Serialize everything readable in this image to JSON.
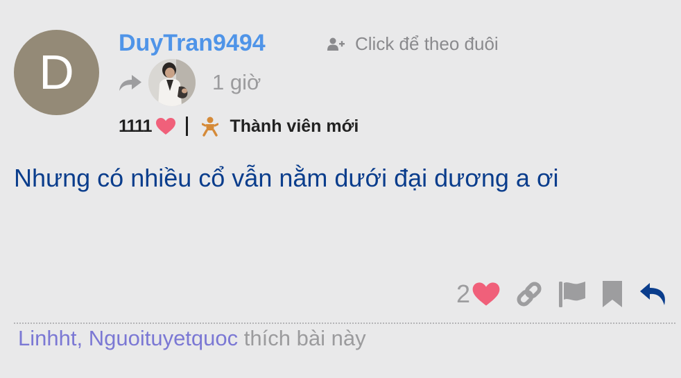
{
  "post": {
    "author": {
      "avatar_letter": "D",
      "avatar_color": "#948a77",
      "username": "DuyTran9494",
      "username_color": "#4f94e8"
    },
    "follow_label": "Click để theo đuôi",
    "follow_icon": "user-plus-icon",
    "shared_via": {
      "icon": "share-arrow-icon",
      "avatar": "shared-user-avatar"
    },
    "time": "1 giờ",
    "stats": {
      "likes_count": "1111",
      "likes_icon": "heart-icon",
      "rank_icon": "baby-icon",
      "rank_label": "Thành viên mới"
    },
    "content": "Nhưng có nhiều cổ vẫn nằm dưới đại dương a ơi",
    "content_color": "#0a3d8c",
    "actions": {
      "like_count": "2",
      "icons": [
        "heart-icon",
        "link-icon",
        "flag-icon",
        "bookmark-icon",
        "reply-icon"
      ]
    },
    "liked_by": {
      "users": [
        "Linhht",
        "Nguoituyetquoc"
      ],
      "separator": ",",
      "suffix": "thích bài này"
    }
  },
  "colors": {
    "background": "#e9e9ea",
    "heart": "#f0607a",
    "muted": "#9d9d9f",
    "reply": "#0a3d8c",
    "liker": "#7b78d4"
  }
}
